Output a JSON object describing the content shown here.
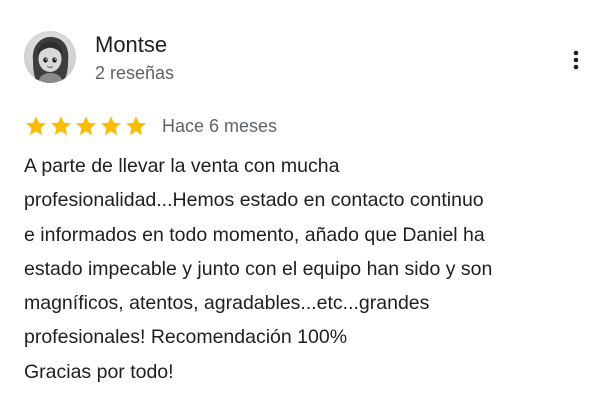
{
  "review": {
    "author": {
      "name": "Montse",
      "review_count": "2 reseñas",
      "avatar_icon": "cartoon-girl-avatar"
    },
    "menu_icon": "more-vert-icon",
    "rating": {
      "value": 5,
      "max": 5,
      "star_color": "#fbbc04",
      "date": "Hace 6 meses"
    },
    "text_lines": [
      "A parte de llevar la venta con mucha",
      "profesionalidad...Hemos estado en contacto continuo",
      "e informados en todo momento, añado que Daniel ha",
      "estado impecable y junto con el equipo han sido y son",
      "magníficos, atentos, agradables...etc...grandes",
      "profesionales! Recomendación 100%",
      "Gracias por todo!"
    ]
  },
  "colors": {
    "primary_text": "#1f1f1f",
    "secondary_text": "#5f6368",
    "background": "#ffffff"
  }
}
